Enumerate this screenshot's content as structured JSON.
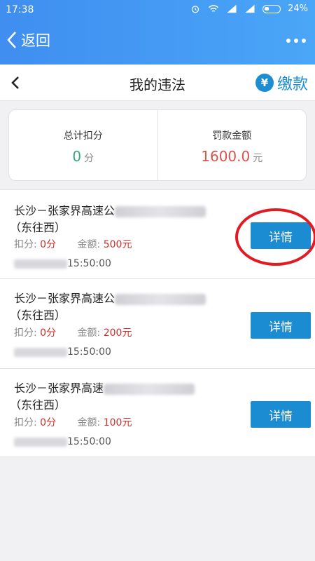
{
  "status_bar": {
    "time": "17:38",
    "battery": "24%"
  },
  "app_bar": {
    "back_label": "返回"
  },
  "title_bar": {
    "title": "我的违法",
    "pay_label": "缴款",
    "pay_icon_glyph": "¥"
  },
  "summary": {
    "points_label": "总计扣分",
    "points_value": "0",
    "points_unit": "分",
    "amount_label": "罚款金额",
    "amount_value": "1600.0",
    "amount_unit": "元"
  },
  "violations": [
    {
      "road": "长沙－张家界高速公",
      "direction": "（东往西）",
      "points_label": "扣分:",
      "points": "0分",
      "amount_label": "金额:",
      "amount": "500元",
      "time": "15:50:00",
      "detail_label": "详情"
    },
    {
      "road": "长沙－张家界高速公",
      "direction": "（东往西）",
      "points_label": "扣分:",
      "points": "0分",
      "amount_label": "金额:",
      "amount": "200元",
      "time": "15:50:00",
      "detail_label": "详情"
    },
    {
      "road": "长沙－张家界高速",
      "direction": "（东往西）",
      "points_label": "扣分:",
      "points": "0分",
      "amount_label": "金额:",
      "amount": "100元",
      "time": "15:50:00",
      "detail_label": "详情"
    }
  ],
  "colors": {
    "header": "#4aa6f7",
    "button": "#1b8bd2",
    "points": "#3aa57a",
    "amount": "#d9534f",
    "highlight": "#e01b24"
  }
}
